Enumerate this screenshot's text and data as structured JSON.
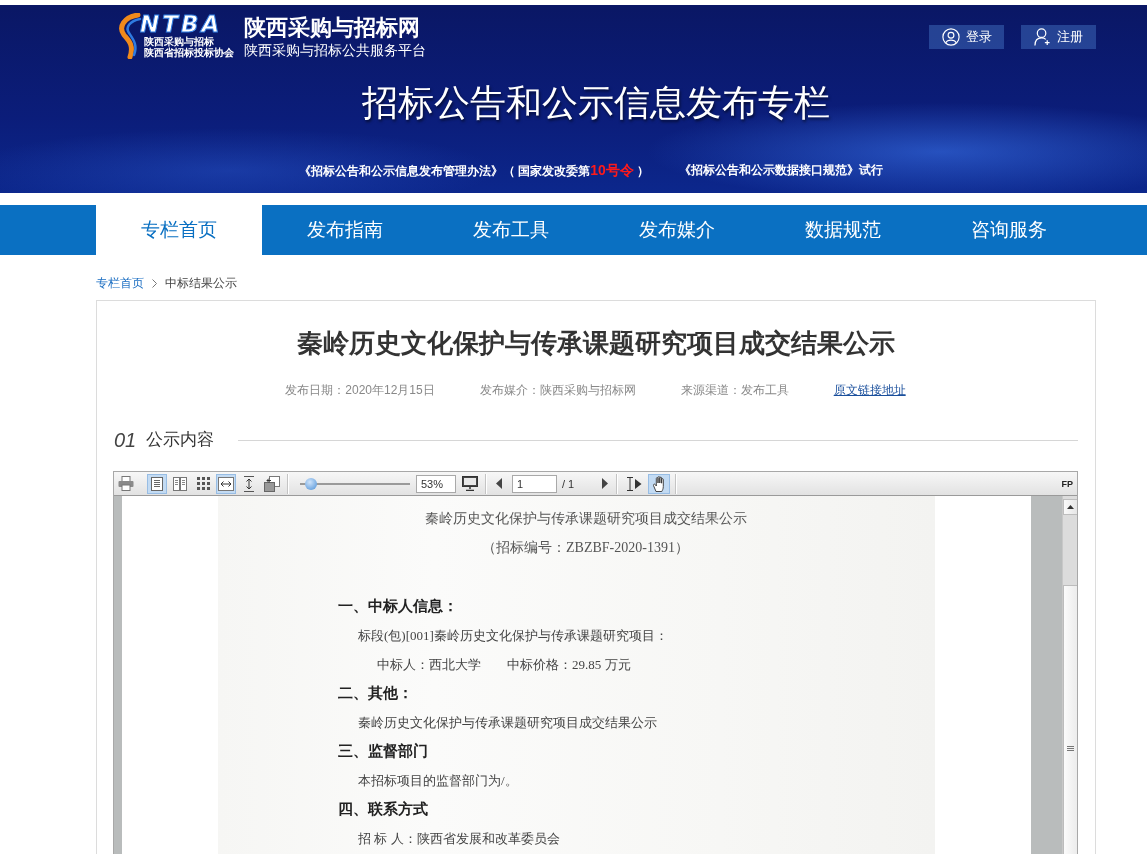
{
  "header": {
    "logo": {
      "mark": "NTBA",
      "captions": [
        "陕西采购与招标",
        "陕西省招标投标协会"
      ]
    },
    "site_name": "陕西采购与招标网",
    "site_subtitle": "陕西采购与招标公共服务平台",
    "account_buttons": [
      {
        "kind": "login",
        "label": "登录"
      },
      {
        "kind": "register",
        "label": "注册"
      }
    ],
    "banner_title": "招标公告和公示信息发布专栏",
    "notices": [
      {
        "parts": [
          {
            "text": "《招标公告和公示信息发布管理办法》（ 国家发改委第",
            "highlight": false
          },
          {
            "text": "10号令",
            "highlight": true
          },
          {
            "text": " ）",
            "highlight": false
          }
        ]
      },
      {
        "parts": [
          {
            "text": "《招标公告和公示数据接口规范》试行",
            "highlight": false
          }
        ]
      }
    ]
  },
  "nav": {
    "tabs": [
      {
        "label": "专栏首页",
        "selected": true
      },
      {
        "label": "发布指南",
        "selected": false
      },
      {
        "label": "发布工具",
        "selected": false
      },
      {
        "label": "发布媒介",
        "selected": false
      },
      {
        "label": "数据规范",
        "selected": false
      },
      {
        "label": "咨询服务",
        "selected": false
      }
    ]
  },
  "breadcrumb": [
    {
      "kind": "link",
      "label": "专栏首页"
    },
    {
      "kind": "current",
      "label": "中标结果公示"
    }
  ],
  "article": {
    "title": "秦岭历史文化保护与传承课题研究项目成交结果公示",
    "meta": [
      {
        "kind": "text",
        "text": "发布日期：2020年12月15日"
      },
      {
        "kind": "text",
        "text": "发布媒介：陕西采购与招标网"
      },
      {
        "kind": "text",
        "text": "来源渠道：发布工具"
      },
      {
        "kind": "link",
        "text": "原文链接地址"
      }
    ],
    "section": {
      "number": "01",
      "title": "公示内容"
    },
    "viewer": {
      "toolbar": {
        "page_modes": [
          {
            "kind": "single",
            "selected": true
          },
          {
            "kind": "double",
            "selected": false
          },
          {
            "kind": "grid",
            "selected": false
          }
        ],
        "fit_modes": [
          {
            "kind": "width",
            "selected": true
          },
          {
            "kind": "height",
            "selected": false
          }
        ],
        "zoom": {
          "level": 0.05,
          "value": "53%"
        },
        "page": {
          "value": "1",
          "total": "/ 1"
        },
        "tools": [
          {
            "kind": "text_select",
            "selected": false
          },
          {
            "kind": "hand",
            "selected": true
          }
        ],
        "brand": "FP"
      },
      "document": {
        "title": "秦岭历史文化保护与传承课题研究项目成交结果公示",
        "number": "（招标编号：ZBZBF-2020-1391）",
        "sections": [
          {
            "heading": "一、中标人信息：",
            "lines": [
              {
                "kind": "text",
                "texts": [
                  "标段(包)[001]秦岭历史文化保护与传承课题研究项目："
                ]
              },
              {
                "kind": "pair",
                "texts": [
                  "中标人：西北大学",
                  "中标价格：29.85 万元"
                ]
              }
            ]
          },
          {
            "heading": "二、其他：",
            "lines": [
              {
                "kind": "text",
                "texts": [
                  "秦岭历史文化保护与传承课题研究项目成交结果公示"
                ]
              }
            ]
          },
          {
            "heading": "三、监督部门",
            "lines": [
              {
                "kind": "text",
                "texts": [
                  "本招标项目的监督部门为/。"
                ]
              }
            ]
          },
          {
            "heading": "四、联系方式",
            "lines": [
              {
                "kind": "text",
                "texts": [
                  "招 标 人：陕西省发展和改革委员会"
                ]
              }
            ]
          }
        ]
      }
    }
  }
}
